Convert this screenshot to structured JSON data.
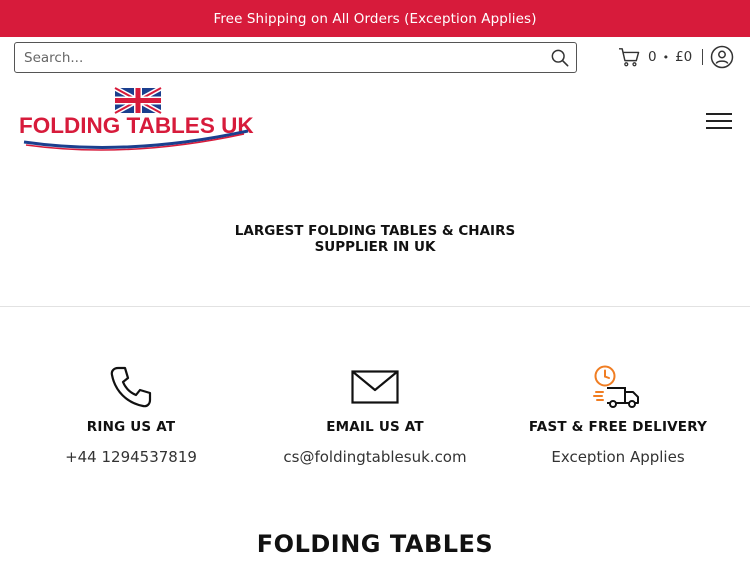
{
  "announcement": {
    "text": "Free Shipping on All Orders (Exception Applies)"
  },
  "search": {
    "placeholder": "Search..."
  },
  "cart": {
    "count": "0",
    "separator": "•",
    "total": "£0"
  },
  "logo": {
    "text": "FOLDING TABLES UK"
  },
  "tagline": {
    "line1": "LARGEST FOLDING TABLES & CHAIRS",
    "line2": "SUPPLIER IN UK"
  },
  "features": [
    {
      "icon": "phone-icon",
      "title": "RING US AT",
      "subtitle": "+44 1294537819"
    },
    {
      "icon": "envelope-icon",
      "title": "EMAIL US AT",
      "subtitle": "cs@foldingtablesuk.com"
    },
    {
      "icon": "delivery-truck-icon",
      "title": "FAST & FREE DELIVERY",
      "subtitle": "Exception Applies"
    }
  ],
  "section": {
    "title": "FOLDING TABLES"
  },
  "colors": {
    "announcement_bg": "#d71b3b",
    "delivery_accent": "#f07d22",
    "logo_red": "#d71b3b",
    "logo_blue": "#1b3f8e"
  }
}
